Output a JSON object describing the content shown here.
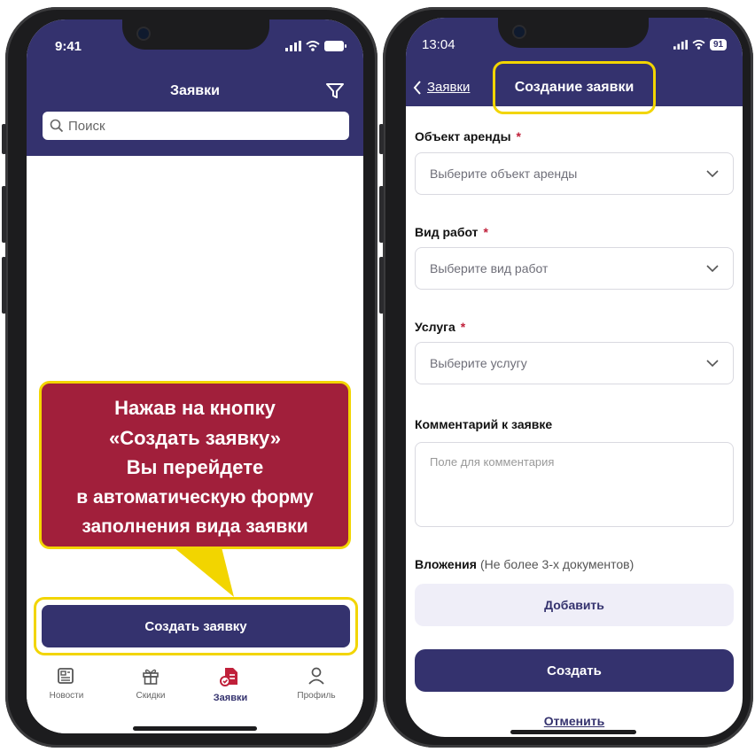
{
  "left_screen": {
    "status_time": "9:41",
    "title": "Заявки",
    "search": {
      "placeholder": "Поиск"
    },
    "callout_lines": [
      "Нажав на кнопку",
      "«Создать заявку»",
      "Вы перейдете",
      "в автоматическую форму",
      "заполнения вида заявки"
    ],
    "create_button": "Создать заявку",
    "tabs": [
      {
        "label": "Новости",
        "icon": "newspaper-icon"
      },
      {
        "label": "Скидки",
        "icon": "gift-icon"
      },
      {
        "label": "Заявки",
        "icon": "document-icon"
      },
      {
        "label": "Профиль",
        "icon": "person-icon"
      }
    ],
    "active_tab_index": 2
  },
  "right_screen": {
    "status_time": "13:04",
    "battery": "91",
    "back_label": "Заявки",
    "title": "Создание заявки",
    "fields": [
      {
        "label": "Объект аренды",
        "required_mark": "*",
        "placeholder": "Выберите объект аренды"
      },
      {
        "label": "Вид работ",
        "required_mark": "*",
        "placeholder": "Выберите вид работ"
      },
      {
        "label": "Услуга",
        "required_mark": "*",
        "placeholder": "Выберите услугу"
      }
    ],
    "comment": {
      "label": "Комментарий к заявке",
      "placeholder": "Поле для комментария"
    },
    "attachments": {
      "label": "Вложения",
      "hint": "(Не более 3-х документов)",
      "add_button": "Добавить"
    },
    "submit_button": "Создать",
    "cancel_link": "Отменить"
  },
  "colors": {
    "primary": "#34326e",
    "callout": "#a11f3b",
    "highlight": "#f2d500",
    "required": "#c0203a"
  }
}
